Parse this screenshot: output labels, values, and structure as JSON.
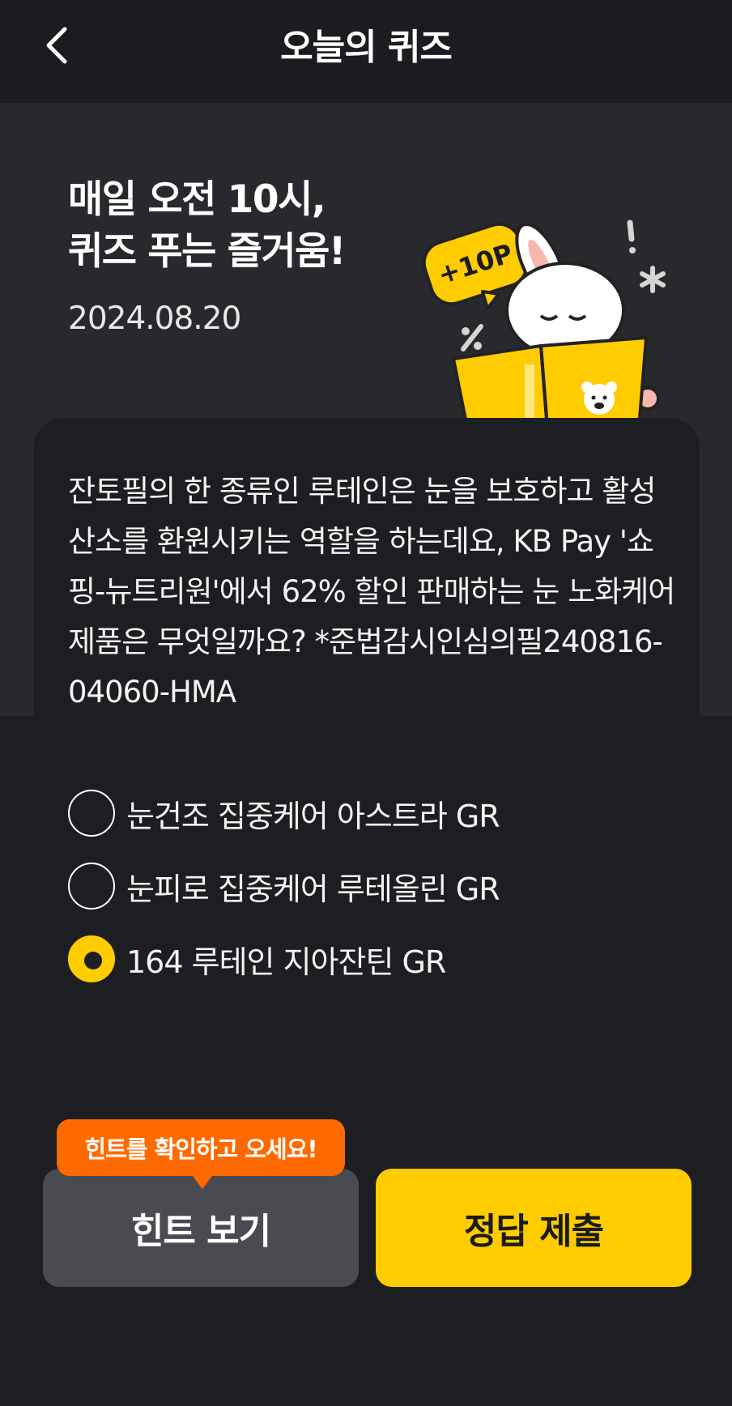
{
  "header": {
    "title": "오늘의 퀴즈",
    "back_icon": "chevron-left-icon"
  },
  "hero": {
    "headline_line1": "매일 오전 10시,",
    "headline_line2": "퀴즈 푸는 즐거움!",
    "date": "2024.08.20",
    "badge_text": "+10P"
  },
  "question": {
    "text": "잔토필의 한 종류인 루테인은 눈을 보호하고 활성 산소를 환원시키는 역할을 하는데요, KB Pay '쇼핑-뉴트리원'에서 62% 할인 판매하는 눈 노화케어 제품은 무엇일까요? *준법감시인심의필240816-04060-HMA"
  },
  "options": [
    {
      "label": "눈건조 집중케어 아스트라 GR",
      "selected": false
    },
    {
      "label": "눈피로 집중케어 루테올린 GR",
      "selected": false
    },
    {
      "label": "164 루테인 지아잔틴 GR",
      "selected": true
    }
  ],
  "tooltip": {
    "text": "힌트를 확인하고 오세요!"
  },
  "buttons": {
    "hint_label": "힌트 보기",
    "submit_label": "정답 제출"
  },
  "colors": {
    "accent": "#ffcc00",
    "tooltip": "#ff6a00",
    "background": "#1d1e21",
    "hero": "#28292d"
  }
}
